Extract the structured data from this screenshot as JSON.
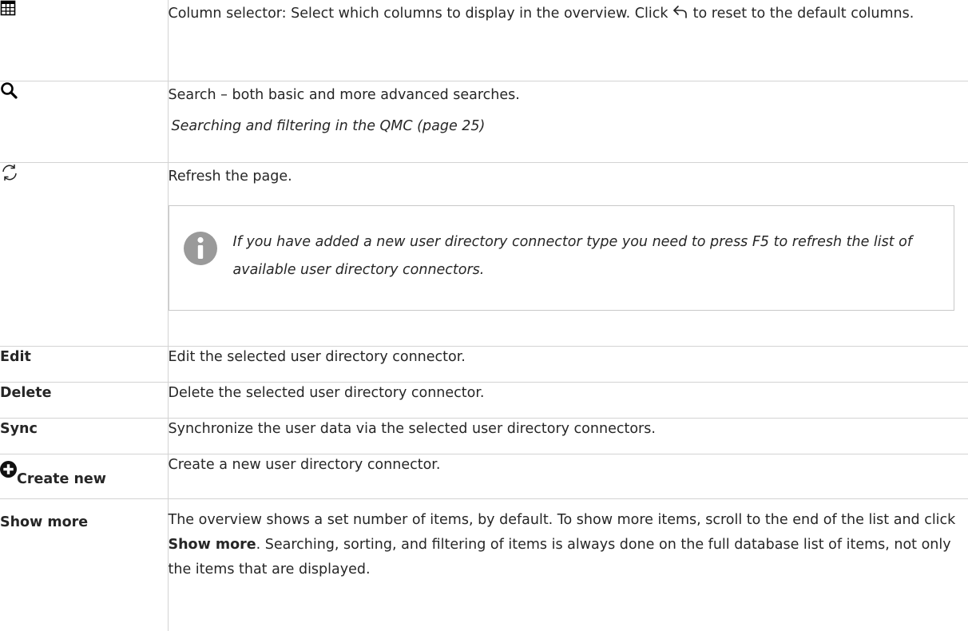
{
  "rows": {
    "column_selector": {
      "icon": "table-icon",
      "desc_before": "Column selector: Select which columns to display in the overview. Click",
      "desc_icon": "undo-arrow-icon",
      "desc_after": "to reset to the default columns."
    },
    "search": {
      "icon": "search-icon",
      "desc": "Search – both basic and more advanced searches.",
      "link": "Searching and filtering in the QMC (page 25)"
    },
    "refresh": {
      "icon": "refresh-icon",
      "desc": "Refresh the page.",
      "note_icon": "info-icon",
      "note": "If you have added a new user directory connector type you need to press F5 to refresh the list of available user directory connectors."
    },
    "edit": {
      "label": "Edit",
      "desc": "Edit the selected user directory connector."
    },
    "delete": {
      "label": "Delete",
      "desc": "Delete the selected user directory connector."
    },
    "sync": {
      "label": "Sync",
      "desc": "Synchronize the user data via the selected user directory connectors."
    },
    "create_new": {
      "icon": "plus-circle-icon",
      "label": "Create new",
      "desc": "Create a new user directory connector."
    },
    "show_more": {
      "label": "Show more",
      "desc_before": "The overview shows a set number of items, by default. To show more items, scroll to the end of the list and click",
      "desc_bold": "Show more",
      "desc_after": ". Searching, sorting, and filtering of items is always done on the full database list of items, not only the items that are displayed."
    }
  }
}
